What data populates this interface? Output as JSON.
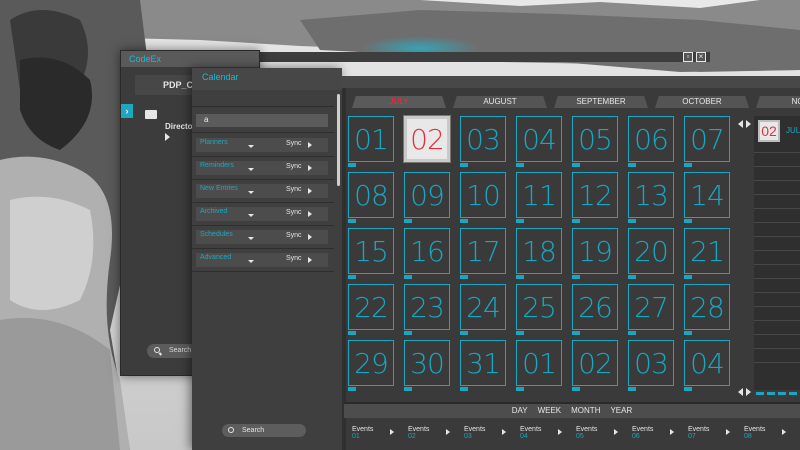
{
  "back_window": {
    "title": "CodeEx",
    "path_label": "PDP_CD",
    "directory_label": "Directori",
    "search_label": "Search"
  },
  "calendar_list": {
    "title": "Calendar",
    "search_value": "a",
    "items": [
      {
        "label": "Planners",
        "action": "Sync"
      },
      {
        "label": "Reminders",
        "action": "Sync"
      },
      {
        "label": "New Entries",
        "action": "Sync"
      },
      {
        "label": "Archived",
        "action": "Sync"
      },
      {
        "label": "Schedules",
        "action": "Sync"
      },
      {
        "label": "Advanced",
        "action": "Sync"
      }
    ],
    "search_label": "Search"
  },
  "calendar": {
    "months": [
      "JULY",
      "AUGUST",
      "SEPTEMBER",
      "OCTOBER",
      "NOVE"
    ],
    "active_month": "JULY",
    "days": [
      "01",
      "02",
      "03",
      "04",
      "05",
      "06",
      "07",
      "08",
      "09",
      "10",
      "11",
      "12",
      "13",
      "14",
      "15",
      "16",
      "17",
      "18",
      "19",
      "20",
      "21",
      "22",
      "23",
      "24",
      "25",
      "26",
      "27",
      "28",
      "29",
      "30",
      "31",
      "01",
      "02",
      "03",
      "04"
    ],
    "today": "02",
    "side_day": "02",
    "side_month": "JUL",
    "views": [
      "DAY",
      "WEEK",
      "MONTH",
      "YEAR"
    ],
    "events": [
      {
        "label": "Events",
        "day": "01"
      },
      {
        "label": "Events",
        "day": "02"
      },
      {
        "label": "Events",
        "day": "03"
      },
      {
        "label": "Events",
        "day": "04"
      },
      {
        "label": "Events",
        "day": "05"
      },
      {
        "label": "Events",
        "day": "06"
      },
      {
        "label": "Events",
        "day": "07"
      },
      {
        "label": "Events",
        "day": "08"
      }
    ]
  },
  "colors": {
    "accent": "#19a6c0",
    "today_text": "#e0323c",
    "panel": "#3a3a3a"
  }
}
